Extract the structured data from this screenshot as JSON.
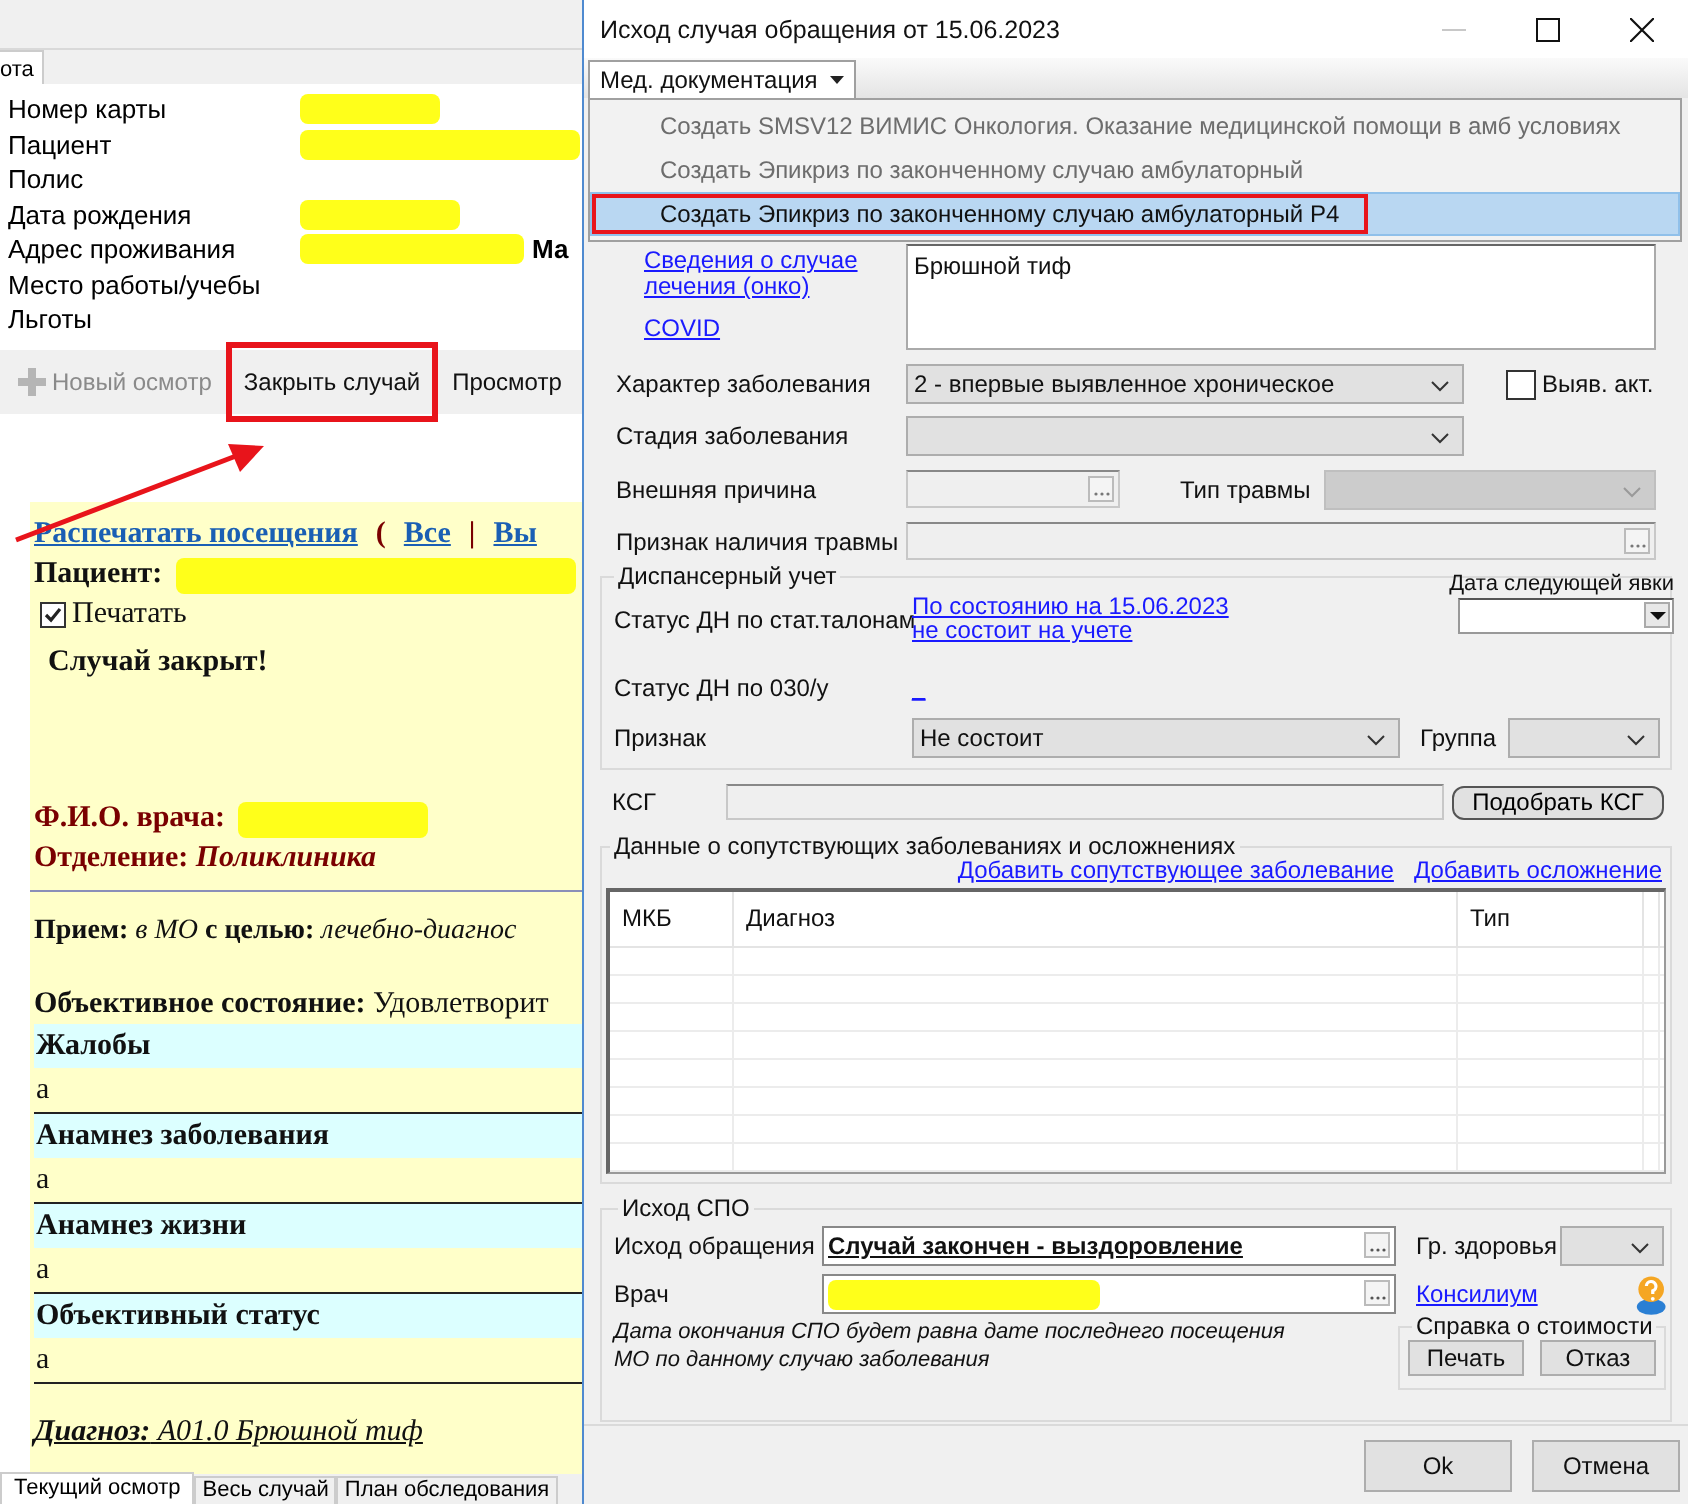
{
  "background_window": {
    "tab": {
      "label": "ота"
    },
    "patient_info": [
      {
        "label": "Номер карты",
        "redacted": true
      },
      {
        "label": "Пациент",
        "redacted": true
      },
      {
        "label": "Полис",
        "redacted": false
      },
      {
        "label": "Дата рождения",
        "redacted": true
      },
      {
        "label": "Адрес проживания",
        "redacted": true,
        "value": "Ма"
      },
      {
        "label": "Место работы/учебы",
        "redacted": false
      },
      {
        "label": "Льготы",
        "redacted": false
      }
    ],
    "toolbar": [
      {
        "label": "Новый осмотр",
        "kind": "add",
        "disabled": true,
        "annotated": false
      },
      {
        "label": "Закрыть случай",
        "kind": "plain",
        "disabled": false,
        "annotated": true
      },
      {
        "label": "Просмотр",
        "kind": "plain",
        "disabled": false,
        "annotated": false
      }
    ],
    "document": {
      "links": [
        {
          "text": "Распечатать посещения",
          "kind": "link"
        },
        {
          "text": "(",
          "kind": "separator"
        },
        {
          "text": "Все",
          "kind": "link"
        },
        {
          "text": "|",
          "kind": "separator"
        },
        {
          "text": "Вы",
          "kind": "link"
        }
      ],
      "patient_label": "Пациент:",
      "patient_redacted": true,
      "print_checkbox": {
        "label": "Печатать",
        "checked": true
      },
      "status": "Случай закрыт!",
      "doctor_label": "Ф.И.О. врача:",
      "doctor_redacted": true,
      "department": "Отделение: *Поликлиника*",
      "reception": "**Прием:** *в МО* **с целью:** *лечебно-диагнос*",
      "objective": "**Объективное состояние:** Удовлетворит",
      "sections": [
        {
          "title": "Жалобы",
          "text": "а"
        },
        {
          "title": "Анамнез заболевания",
          "text": "а"
        },
        {
          "title": "Анамнез жизни",
          "text": "а"
        },
        {
          "title": "Объективный статус",
          "text": "а"
        }
      ],
      "diagnosis": "**Диагноз:** A01.0 Брюшной тиф"
    },
    "bottom_tabs": [
      {
        "label": "Текущий осмотр",
        "selected": true
      },
      {
        "label": "Весь случай",
        "selected": false
      },
      {
        "label": "План обследования",
        "selected": false
      }
    ]
  },
  "dialog": {
    "title": "Исход случая обращения от 15.06.2023",
    "menu": {
      "label": "Мед. документация",
      "expanded": true,
      "items": [
        {
          "label": "Создать SMSV12 ВИМИС Онкология. Оказание медицинской помощи в амб условиях",
          "disabled": true,
          "selected": false,
          "annotated": false
        },
        {
          "label": "Создать Эпикриз по законченному случаю амбулаторный",
          "disabled": true,
          "selected": false,
          "annotated": false
        },
        {
          "label": "Создать Эпикриз по законченному случаю амбулаторный P4",
          "disabled": false,
          "selected": true,
          "annotated": true
        }
      ]
    },
    "side_links": [
      "Сведения о случае лечения (онко)",
      "COVID"
    ],
    "diagnosis_text": "Брюшной тиф",
    "disease_character": {
      "label": "Характер заболевания",
      "value": "2 - впервые выявленное хроническое"
    },
    "revealed_checkbox": {
      "label": "Выяв. акт.",
      "checked": false
    },
    "disease_stage": {
      "label": "Стадия заболевания"
    },
    "external_cause": {
      "label": "Внешняя причина",
      "disabled": true
    },
    "injury_type": {
      "label": "Тип травмы",
      "disabled": true
    },
    "injury_sign": {
      "label": "Признак наличия травмы",
      "disabled": true
    },
    "dispensary": {
      "title": "Диспансерный учет",
      "status_label": "Статус ДН по стат.талонам",
      "status_links": [
        "По состоянию на 15.06.2023",
        "не состоит на учете"
      ],
      "next_visit_label": "Дата следующей явки",
      "form_label": "Статус ДН по 030/у",
      "form_value": "_",
      "sign_label": "Признак",
      "sign_value": "Не состоит",
      "group_label": "Группа"
    },
    "ksg": {
      "label": "КСГ",
      "button": "Подобрать КСГ"
    },
    "comorbid": {
      "title": "Данные о сопутствующих заболеваниях и осложнениях",
      "links": [
        "Добавить сопутствующее заболевание",
        "Добавить осложнение"
      ],
      "columns": [
        "МКБ",
        "Диагноз",
        "Тип"
      ]
    },
    "outcome": {
      "title": "Исход СПО",
      "outcome_label": "Исход обращения",
      "outcome_value": "Случай закончен - выздоровление",
      "health_label": "Гр. здоровья",
      "doctor_label": "Врач",
      "doctor_redacted": true,
      "council_link": "Консилиум",
      "note_lines": [
        "Дата окончания СПО будет равна дате последнего посещения",
        "МО по данному случаю заболевания"
      ],
      "cost": {
        "title": "Справка о стоимости",
        "buttons": [
          "Печать",
          "Отказ"
        ]
      }
    },
    "buttons": [
      "Ok",
      "Отмена"
    ]
  }
}
